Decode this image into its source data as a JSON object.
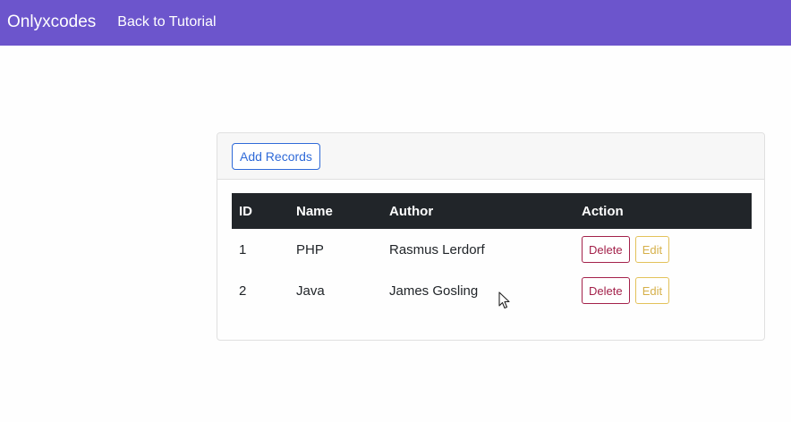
{
  "navbar": {
    "brand": "Onlyxcodes",
    "link": "Back to Tutorial"
  },
  "card": {
    "add_button": "Add Records"
  },
  "table": {
    "headers": [
      "ID",
      "Name",
      "Author",
      "Action"
    ],
    "rows": [
      {
        "id": "1",
        "name": "PHP",
        "author": "Rasmus Lerdorf",
        "delete": "Delete",
        "edit": "Edit"
      },
      {
        "id": "2",
        "name": "Java",
        "author": "James Gosling",
        "delete": "Delete",
        "edit": "Edit"
      }
    ]
  },
  "colors": {
    "navbar": "#6c55cc",
    "primary": "#2f6ad8",
    "danger": "#a3214a",
    "warning": "#e3c25a",
    "table_header": "#212529"
  },
  "icons": {
    "cursor": "mouse-pointer-icon"
  }
}
